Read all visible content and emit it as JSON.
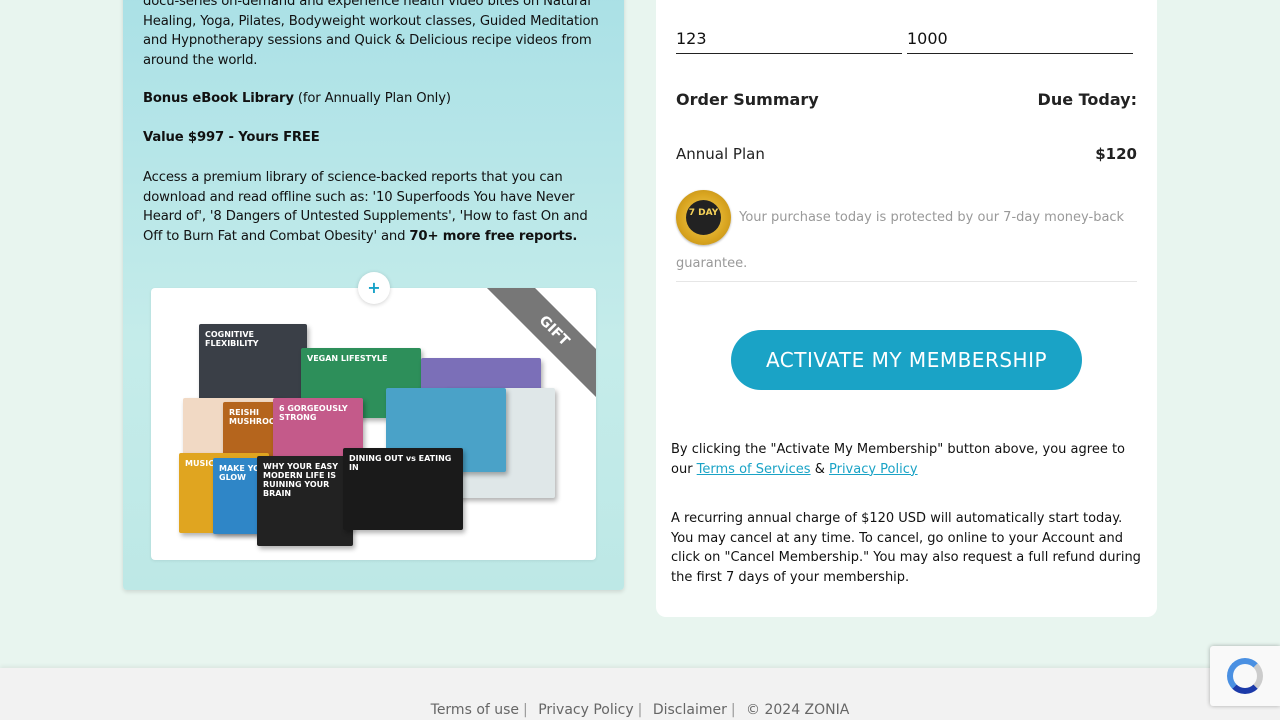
{
  "left": {
    "intro_text": "docu-series on-demand and experience health video bites on Natural Healing, Yoga, Pilates, Bodyweight workout classes, Guided Meditation and Hypnotherapy sessions and Quick & Delicious recipe videos from around the world.",
    "bonus_title": "Bonus eBook Library",
    "bonus_note": " (for Annually Plan Only)",
    "value_line": "Value $997 - Yours FREE",
    "access_text": "Access a premium library of science-backed reports that you can download and read offline such as: '10 Superfoods You have Never Heard of', '8 Dangers of Untested Supplements', 'How to fast On and Off to Burn Fat and Combat Obesity' and ",
    "access_bold": "70+ more free reports.",
    "plus_label": "+",
    "ribbon_label": "GIFT",
    "books": [
      {
        "title": "COGNITIVE FLEXIBILITY",
        "color": "#3a3f47"
      },
      {
        "title": "VEGAN LIFESTYLE",
        "color": "#2d8f5a"
      },
      {
        "title": "REISHI MUSHROOM",
        "color": "#b5651d"
      },
      {
        "title": "6 GORGEOUSLY STRONG",
        "color": "#c45a8a"
      },
      {
        "title": "DINING OUT vs EATING IN",
        "color": "#1a1a1a"
      },
      {
        "title": "MAKE YOUR SKIN GLOW",
        "color": "#2f86c7"
      },
      {
        "title": "WHY YOUR EASY MODERN LIFE IS RUINING YOUR BRAIN",
        "color": "#222"
      },
      {
        "title": "MUSIC THERAPY",
        "color": "#e0a520"
      }
    ]
  },
  "form": {
    "field1_value": "123",
    "field2_value": "1000"
  },
  "order": {
    "title": "Order Summary",
    "due_label": "Due Today:",
    "plan_name": "Annual Plan",
    "plan_price": "$120",
    "guarantee_text": "Your purchase today is protected by our 7-day money-back guarantee.",
    "badge_label": "7 DAY",
    "cta_label": "ACTIVATE MY MEMBERSHIP"
  },
  "legal": {
    "agree_prefix": "By clicking the \"Activate My Membership\" button above, you agree to our ",
    "terms_link": "Terms of Services",
    "amp": " & ",
    "privacy_link": "Privacy Policy",
    "recurring_text": "A recurring annual charge of $120 USD will automatically start today. You may cancel at any time. To cancel, go online to your Account and click on \"Cancel Membership.\" You may also request a full refund during the first 7 days of your membership."
  },
  "footer": {
    "links": [
      "Terms of use",
      "Privacy Policy",
      "Disclaimer"
    ],
    "copyright": "© 2024 ZONIA"
  },
  "colors": {
    "accent": "#1aa3c6",
    "panel_gradient_top": "#a9e0e6",
    "page_bg": "#e8f5ef"
  }
}
